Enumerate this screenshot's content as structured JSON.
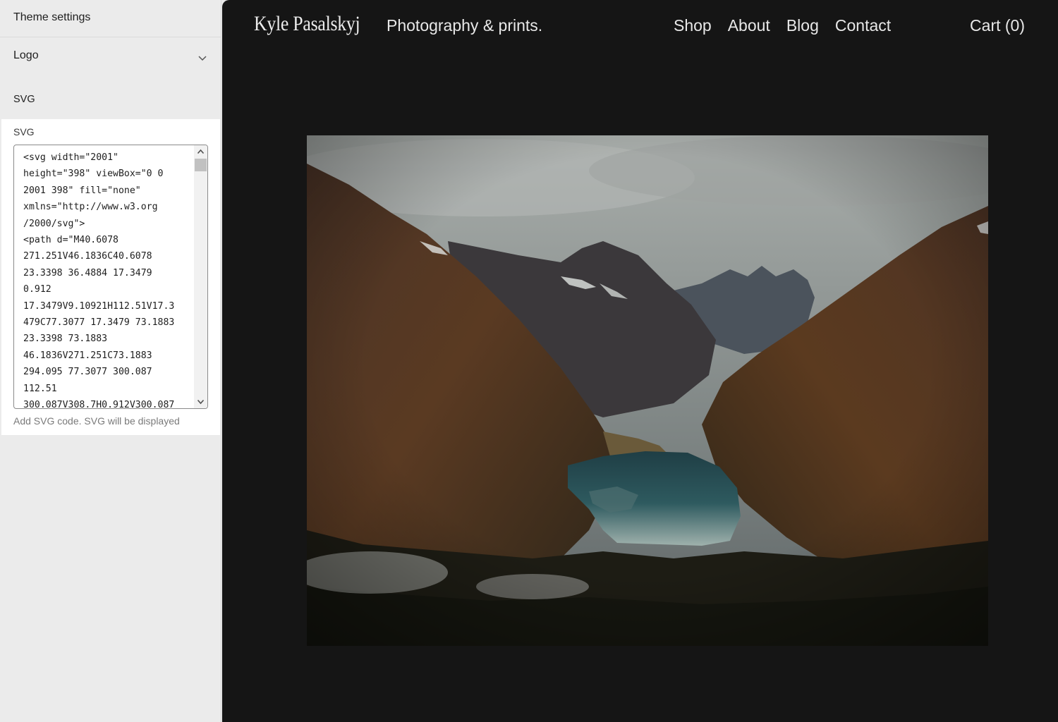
{
  "sidebar": {
    "header_title": "Theme settings",
    "section_title": "Logo",
    "subsection_title": "SVG",
    "field_label": "SVG",
    "code_value": "<svg width=\"2001\"\nheight=\"398\" viewBox=\"0 0\n2001 398\" fill=\"none\"\nxmlns=\"http://www.w3.org\n/2000/svg\">\n<path d=\"M40.6078\n271.251V46.1836C40.6078\n23.3398 36.4884 17.3479\n0.912\n17.3479V9.10921H112.51V17.3\n479C77.3077 17.3479 73.1883\n23.3398 73.1883\n46.1836V271.251C73.1883\n294.095 77.3077 300.087\n112.51\n300.087V308.7H0.912V300.087",
    "help_text": "Add SVG code. SVG will be displayed"
  },
  "preview": {
    "logo_text": "Kyle Pasalskyj",
    "tagline": "Photography & prints.",
    "nav": [
      "Shop",
      "About",
      "Blog",
      "Contact"
    ],
    "cart_label": "Cart (0)"
  },
  "colors": {
    "sidebar_bg": "#ebebeb",
    "preview_bg": "#151515",
    "nav_text": "#e8e8e8"
  }
}
